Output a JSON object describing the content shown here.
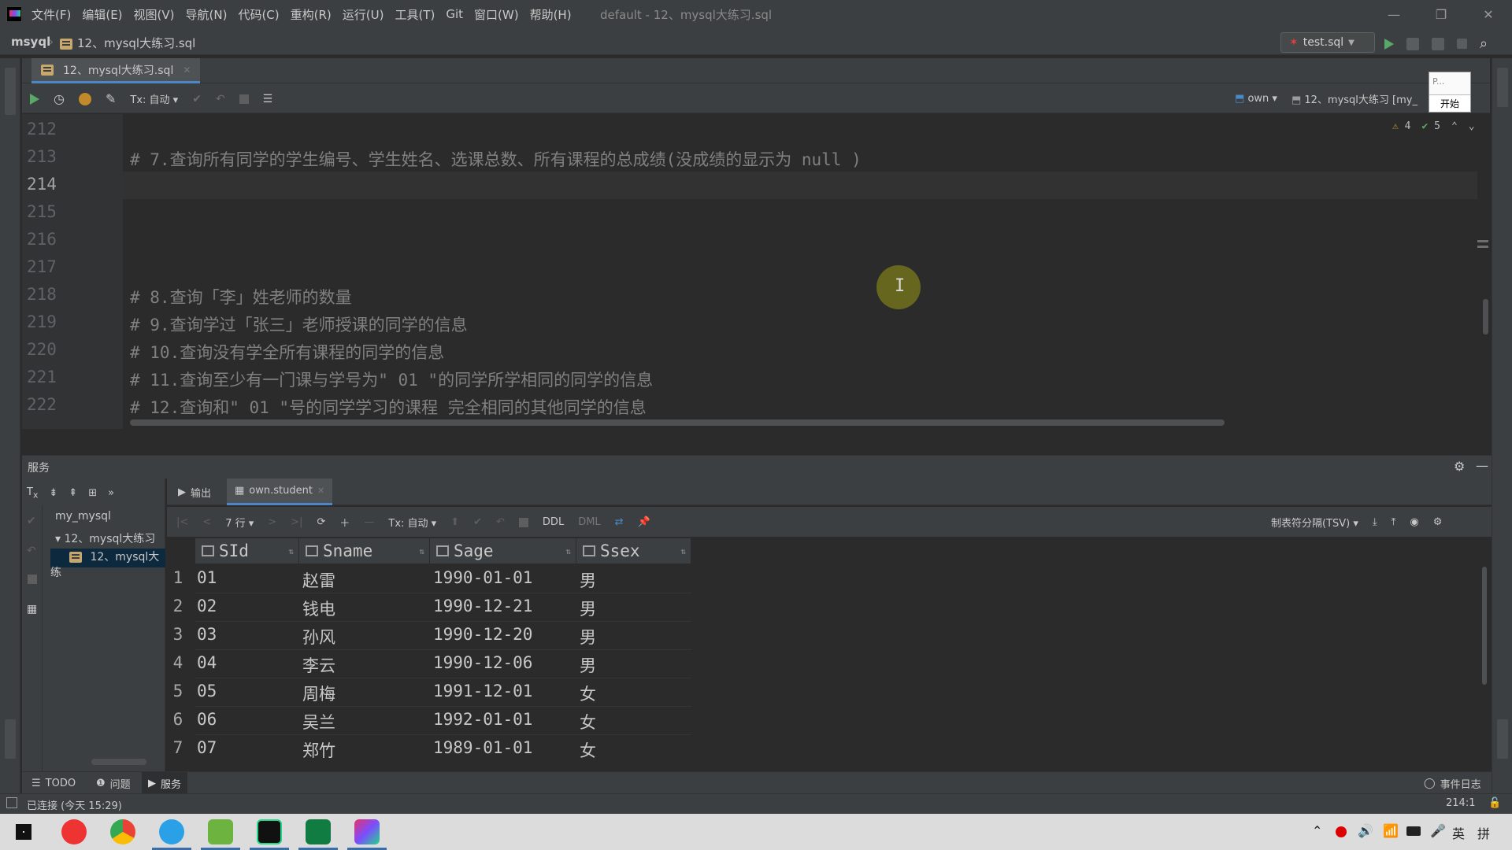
{
  "menu": [
    "文件(F)",
    "编辑(E)",
    "视图(V)",
    "导航(N)",
    "代码(C)",
    "重构(R)",
    "运行(U)",
    "工具(T)",
    "Git",
    "窗口(W)",
    "帮助(H)"
  ],
  "window_title": "default - 12、mysql大练习.sql",
  "breadcrumb": {
    "project": "msyql",
    "file": "12、mysql大练习.sql"
  },
  "run_config": "test.sql",
  "editor_tab": "12、mysql大练习.sql",
  "editor_toolbar": {
    "tx": "Tx: 自动",
    "schema": "own",
    "console": "12、mysql大练习 [my_"
  },
  "popup": {
    "text": "P...",
    "button": "开始"
  },
  "inspections": {
    "warnings": "4",
    "ok": "5"
  },
  "editor": {
    "lines": [
      {
        "no": "212",
        "text": ""
      },
      {
        "no": "213",
        "text": "# 7.查询所有同学的学生编号、学生姓名、选课总数、所有课程的总成绩(没成绩的显示为 null )"
      },
      {
        "no": "214",
        "text": ""
      },
      {
        "no": "215",
        "text": ""
      },
      {
        "no": "216",
        "text": ""
      },
      {
        "no": "217",
        "text": ""
      },
      {
        "no": "218",
        "text": "# 8.查询「李」姓老师的数量"
      },
      {
        "no": "219",
        "text": "# 9.查询学过「张三」老师授课的同学的信息"
      },
      {
        "no": "220",
        "text": "# 10.查询没有学全所有课程的同学的信息"
      },
      {
        "no": "221",
        "text": "# 11.查询至少有一门课与学号为\" 01 \"的同学所学相同的同学的信息"
      },
      {
        "no": "222",
        "text": "# 12.查询和\" 01 \"号的同学学习的课程 完全相同的其他同学的信息"
      }
    ]
  },
  "services": {
    "title": "服务",
    "tree": [
      {
        "label": "my_mysql"
      },
      {
        "label": "12、mysql大练习"
      },
      {
        "label": "12、mysql大练"
      }
    ],
    "tabs": [
      "输出",
      "own.student"
    ],
    "grid_toolbar": {
      "rows": "7 行",
      "tx": "Tx: 自动",
      "ddl": "DDL",
      "dml": "DML",
      "format": "制表符分隔(TSV)"
    },
    "columns": [
      "SId",
      "Sname",
      "Sage",
      "Ssex"
    ],
    "rows": [
      [
        "01",
        "赵雷",
        "1990-01-01",
        "男"
      ],
      [
        "02",
        "钱电",
        "1990-12-21",
        "男"
      ],
      [
        "03",
        "孙风",
        "1990-12-20",
        "男"
      ],
      [
        "04",
        "李云",
        "1990-12-06",
        "男"
      ],
      [
        "05",
        "周梅",
        "1991-12-01",
        "女"
      ],
      [
        "06",
        "吴兰",
        "1992-01-01",
        "女"
      ],
      [
        "07",
        "郑竹",
        "1989-01-01",
        "女"
      ]
    ],
    "row_numbers": [
      "1",
      "2",
      "3",
      "4",
      "5",
      "6",
      "7"
    ]
  },
  "tool_tabs": [
    "TODO",
    "问题",
    "服务"
  ],
  "event_log": "事件日志",
  "status": {
    "connection": "已连接 (今天 15:29)",
    "position": "214:1"
  },
  "taskbar": {
    "ime": "英",
    "ime2": "拼"
  },
  "icons": [
    "app-logo-icon",
    "run-icon",
    "history-icon",
    "settings-icon",
    "wrench-icon",
    "search-icon",
    "gear-icon",
    "minimize-icon",
    "refresh-icon",
    "add-icon",
    "remove-icon",
    "download-icon",
    "upload-icon",
    "eye-icon",
    "pin-icon"
  ]
}
